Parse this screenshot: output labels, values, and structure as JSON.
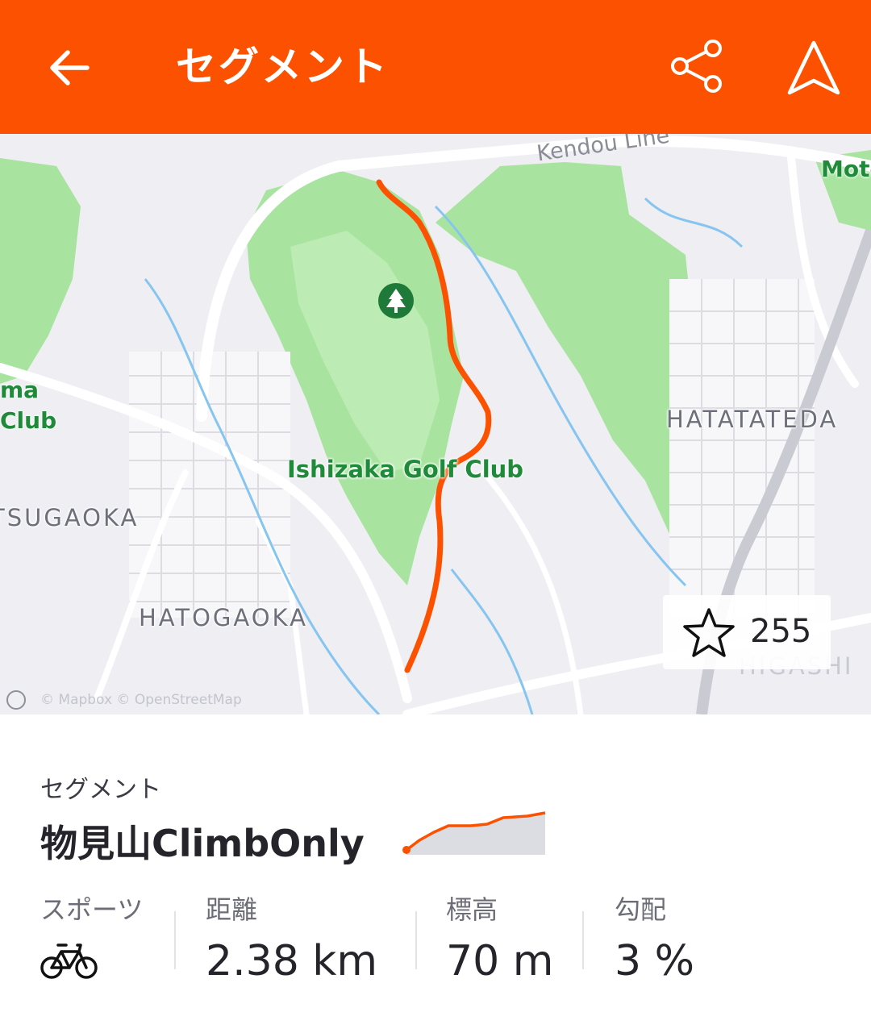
{
  "header": {
    "title": "セグメント",
    "back_icon": "arrow-left-icon",
    "share_icon": "share-icon",
    "navigate_icon": "navigation-arrow-icon",
    "background_color": "#fc5200"
  },
  "map": {
    "labels": {
      "golf_club": "Ishizaka Golf Club",
      "hatatateda": "HATATATEDA",
      "tsugaoka": "TSUGAOKA",
      "hatogaoka": "HATOGAOKA",
      "higashi": "HIGASHI",
      "kendo_line": "Kendou Line",
      "moto": "Moto",
      "golf_left_1": "ma",
      "golf_left_2": "Club"
    },
    "attribution": "© Mapbox © OpenStreetMap",
    "star_count": "255",
    "route_color": "#fc5200",
    "park_color": "#a8e4a0",
    "water_color": "#86c5f0"
  },
  "segment": {
    "kicker": "セグメント",
    "name": "物見山ClimbOnly",
    "stats": [
      {
        "label": "スポーツ",
        "icon": "bicycle-icon"
      },
      {
        "label": "距離",
        "value": "2.38 km"
      },
      {
        "label": "標高",
        "value": "70 m"
      },
      {
        "label": "勾配",
        "value": "3 %"
      }
    ]
  }
}
